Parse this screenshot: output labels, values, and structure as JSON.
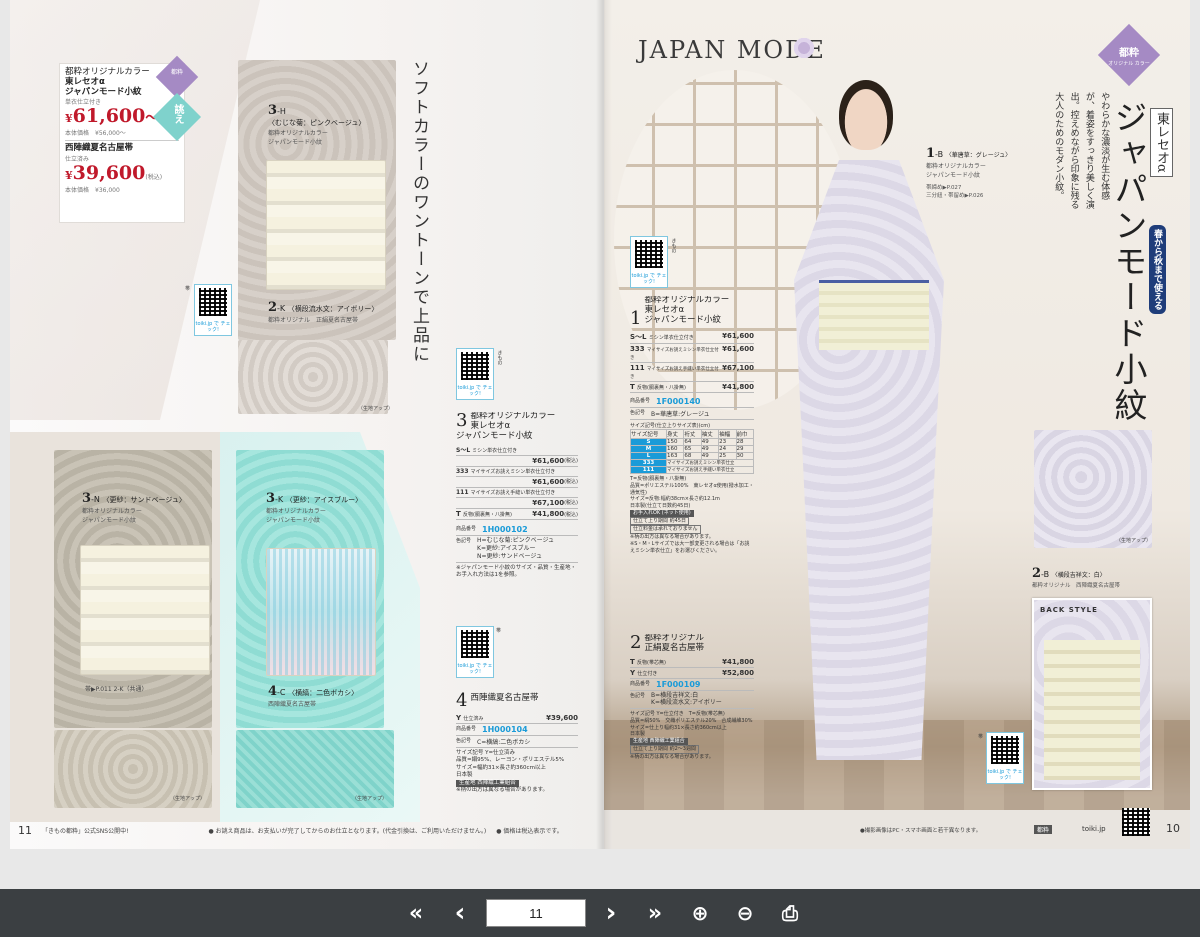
{
  "left_page": {
    "headline": "ソフトカラーのワントーンで上品に",
    "price_box": {
      "line1": "都粋オリジナルカラー",
      "line2": "東レセオα",
      "line3": "ジャパンモード小紋",
      "line4": "単衣仕立付き",
      "price1": "61,600",
      "price1_prefix": "¥",
      "price1_suffix": "〜",
      "tax_note": "(税込)",
      "base1": "本体価格　¥56,000〜",
      "obi_name": "西陣織夏名古屋帯",
      "obi_sub": "仕立済み",
      "price2": "39,600",
      "price2_prefix": "¥",
      "base2": "本体価格　¥36,000"
    },
    "badge_top": "都粋",
    "badge_kanji": "誂え",
    "items": {
      "h3": {
        "num": "3",
        "code": "-H",
        "desc": "〈むじな菊：ピンクベージュ〉",
        "sub1": "都粋オリジナルカラー",
        "sub2": "ジャパンモード小紋"
      },
      "k2": {
        "num": "2",
        "code": "-K",
        "desc": "〈横段流水文：アイボリー〉",
        "sub": "都粋オリジナル　正絹夏名古屋帯"
      },
      "n3": {
        "num": "3",
        "code": "-N",
        "desc": "〈更紗：サンドベージュ〉",
        "sub1": "都粋オリジナルカラー",
        "sub2": "ジャパンモード小紋"
      },
      "k3": {
        "num": "3",
        "code": "-K",
        "desc": "〈更紗：アイスブルー〉",
        "sub1": "都粋オリジナルカラー",
        "sub2": "ジャパンモード小紋"
      },
      "c4": {
        "num": "4",
        "code": "-C",
        "desc": "〈横縞：二色ボカシ〉",
        "sub": "西陣織夏名古屋帯"
      }
    },
    "ref_note": "帯▶P.011 2-K（共通）",
    "closeup": "（生地アップ）",
    "qr_caption": "toiki.jp で チェック!",
    "qr_label": "きもの",
    "qr_label2": "帯",
    "spec3": {
      "title1": "都粋オリジナルカラー",
      "title2": "東レセオα",
      "title3": "ジャパンモード小紋",
      "num": "3",
      "rows": [
        {
          "code": "S〜L",
          "desc": "ミシン単衣仕立付き",
          "price": "¥61,600"
        },
        {
          "code": "333",
          "desc": "マイサイズお誂えミシン単衣仕立付き",
          "price": "¥61,600"
        },
        {
          "code": "111",
          "desc": "マイサイズお誂え手縫い単衣仕立付き",
          "price": "¥67,100"
        },
        {
          "code": "T",
          "desc": "反物(胴裏無・八掛無)",
          "price": "¥41,800"
        }
      ],
      "tax": "(税込)",
      "prod_label": "商品番号",
      "prod_code": "1H000102",
      "color_label": "色記号",
      "colors": [
        "H=むじな菊:ピンクベージュ",
        "K=更紗:アイスブルー",
        "N=更紗:サンドベージュ"
      ],
      "note": "※ジャパンモード小紋のサイズ・品質・生産地・お手入れ方法は1を参照。"
    },
    "spec4": {
      "num": "4",
      "title": "西陣織夏名古屋帯",
      "row_code": "Y",
      "row_desc": "仕立済み",
      "row_price": "¥39,600",
      "prod_label": "商品番号",
      "prod_code": "1H000104",
      "color_label": "色記号",
      "color": "C=横縞:二色ボカシ",
      "size_label": "サイズ記号",
      "size_val": "Y=仕立済み",
      "quality": "品質=絹95%、レーヨン・ポリエステル5%",
      "size_note": "サイズ=幅約31×長さ約360cm以上",
      "origin": "日本製",
      "tag": "生産地 西陣織工業組合",
      "footnote": "※柄の出方は異なる場合があります。"
    },
    "footer_page": "11",
    "footer_left": "「きもの都粋」公式SNS公開中!",
    "footer_mid": "● お誂え商品は、お支払いが完了してからのお仕立となります。(代金引換は、ご利用いただけません。)",
    "footer_right": "● 価格は税込表示です。"
  },
  "right_page": {
    "brand": "JAPAN MODE",
    "badge_top": "都粋",
    "badge_sub": "オリジナル カラー",
    "vertical_title": "ジャパンモード小紋",
    "vertical_small": "東レセオα",
    "season_tag": "春から秋まで使える",
    "vertical_copy": "やわらかな濃淡が生む体感が、着姿をすっきり美しく演出。控えめながら印象に残る大人のためのモダン小紋。",
    "item1b": {
      "num": "1",
      "code": "-B",
      "desc": "〈華唐草：グレージュ〉",
      "sub1": "都粋オリジナルカラー",
      "sub2": "ジャパンモード小紋",
      "ref1": "帯締め▶P.027",
      "ref2": "三分紐・帯留め▶P.026"
    },
    "item2b": {
      "num": "2",
      "code": "-B",
      "desc": "〈横段吉祥文：白〉",
      "sub": "都粋オリジナル　西陣織夏名古屋帯"
    },
    "back_style": "BACK STYLE",
    "closeup": "（生地アップ）",
    "qr_caption": "toiki.jp で チェック!",
    "qr_label": "きもの",
    "qr_label2": "帯",
    "spec1": {
      "num": "1",
      "title1": "都粋オリジナルカラー",
      "title2": "東レセオα",
      "title3": "ジャパンモード小紋",
      "rows": [
        {
          "code": "S〜L",
          "desc": "ミシン単衣仕立付き",
          "price": "¥61,600"
        },
        {
          "code": "333",
          "desc": "マイサイズお誂えミシン単衣仕立付き",
          "price": "¥61,600"
        },
        {
          "code": "111",
          "desc": "マイサイズお誂え手縫い単衣仕立付き",
          "price": "¥67,100"
        },
        {
          "code": "T",
          "desc": "反物(胴裏無・八掛無)",
          "price": "¥41,800"
        }
      ],
      "tax": "(税込)",
      "prod_label": "商品番号",
      "prod_code": "1F000140",
      "color_label": "色記号",
      "color": "B=華唐草:グレージュ",
      "size_table_caption": "サイズ記号(仕立上りサイズ表)(cm)",
      "size_headers": [
        "サイズ記号",
        "身丈",
        "裄丈",
        "袖丈",
        "袖幅",
        "前巾"
      ],
      "size_rows": [
        [
          "S",
          "150",
          "64",
          "49",
          "23",
          "28"
        ],
        [
          "M",
          "160",
          "65",
          "49",
          "24",
          "29"
        ],
        [
          "L",
          "163",
          "68",
          "49",
          "25",
          "30"
        ]
      ],
      "size_333": "333",
      "size_333_desc": "マイサイズお誂えミシン単衣仕立",
      "size_111": "111",
      "size_111_desc": "マイサイズお誂え手縫い単衣仕立",
      "t_line": "T=反物(胴裏無・八掛無)",
      "quality": "品質=ポリエステル100%　東レセオα使用(撥水加工・通気性)",
      "fabric_size": "サイズ=反物:幅約38cm×長さ約12.1m",
      "origin": "日本製(仕立て日数約45日)",
      "tag1": "お手入れOK (ネット使用)",
      "tag2": "仕立て上り期間 約45日",
      "tag3": "仕立料金は承れておりません",
      "note1": "※柄の出方は異なる場合があります。",
      "note2": "※S・M・Lサイズでは大一部変更される場合は「お誂えミシン単衣仕立」をお選びください。"
    },
    "spec2": {
      "num": "2",
      "title1": "都粋オリジナル",
      "title2": "正絹夏名古屋帯",
      "rows": [
        {
          "code": "T",
          "desc": "反物(帯芯無)",
          "price": "¥41,800"
        },
        {
          "code": "Y",
          "desc": "仕立付き",
          "price": "¥52,800"
        }
      ],
      "tax": "(税込)",
      "prod_label": "商品番号",
      "prod_code": "1F000109",
      "color_label": "色記号",
      "colors": [
        "B=横段吉祥文:白",
        "K=横段流水文:アイボリー"
      ],
      "size_label": "サイズ記号",
      "size_val": "Y=仕立付き　T=反物(帯芯無)",
      "quality": "品質=絹50%　交織ポリエステル20%　合成繊維30%",
      "size_note": "サイズ=仕上り幅約31×長さ約360cm以上",
      "origin": "日本製",
      "tag1": "生産地 西陣織工業組合",
      "tag2": "仕立て上り期間 約2〜3週間",
      "footnote": "※柄の出方は異なる場合があります。"
    },
    "footer_note": "●撮影画像はPC・スマホ画面と若干異なります。",
    "footer_brand": "都粋",
    "footer_site": "toiki.jp",
    "footer_page": "10"
  },
  "toolbar": {
    "first_icon": "«",
    "prev_icon": "‹",
    "page_value": "11",
    "next_icon": "›",
    "last_icon": "»",
    "zoom_in_icon": "⊕",
    "zoom_out_icon": "⊖",
    "print_icon": "⎙"
  },
  "colors": {
    "accent_red": "#c0192b",
    "accent_blue": "#1a9bd8",
    "badge_purple": "#a58ac4",
    "toolbar_bg": "#3b3f42"
  }
}
